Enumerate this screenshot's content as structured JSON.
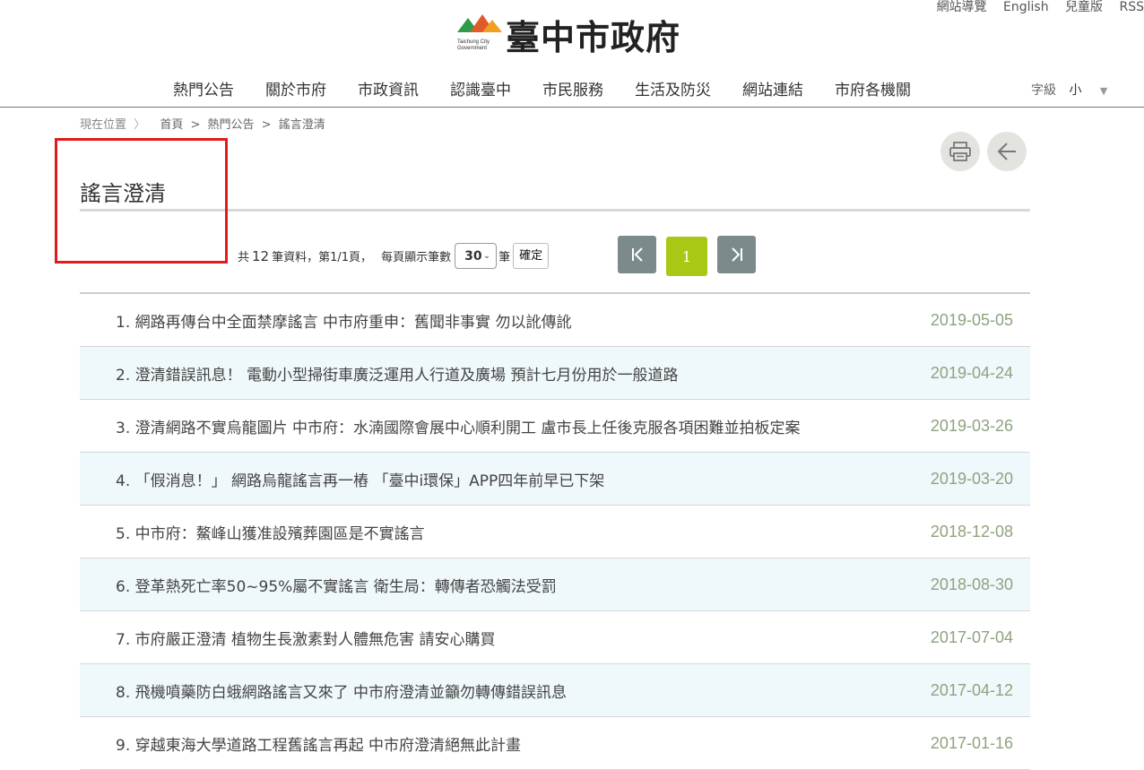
{
  "header": {
    "top_links": [
      "網站導覽",
      "English",
      "兒童版",
      "RSS"
    ],
    "logo": {
      "text": "臺中市政府",
      "caption_line1": "Taichung City",
      "caption_line2": "Government"
    },
    "nav": [
      "熱門公告",
      "關於市府",
      "市政資訊",
      "認識臺中",
      "市民服務",
      "生活及防災",
      "網站連結",
      "市府各機關"
    ],
    "font_size": {
      "label": "字級",
      "value": "小",
      "caret": "▼"
    }
  },
  "breadcrumb": {
    "current_label": "現在位置",
    "chevron": "〉",
    "items": [
      "首頁",
      "熱門公告",
      "謠言澄清"
    ],
    "separator": ">"
  },
  "page_title": "謠言澄清",
  "pager": {
    "prefix": "共",
    "total": "12",
    "records_text": "筆資料，第",
    "page_fraction": "1/1頁，",
    "per_page_label": "每頁顯示筆數",
    "per_page_value": "30",
    "per_page_unit": "筆",
    "confirm_label": "確定",
    "current_page": "1"
  },
  "list": [
    {
      "num": "1.",
      "title": "網路再傳台中全面禁摩謠言 中市府重申：舊聞非事實 勿以訛傳訛",
      "date": "2019-05-05"
    },
    {
      "num": "2.",
      "title": "澄清錯誤訊息！ 電動小型掃街車廣泛運用人行道及廣場 預計七月份用於一般道路",
      "date": "2019-04-24"
    },
    {
      "num": "3.",
      "title": "澄清網路不實烏龍圖片 中市府：水湳國際會展中心順利開工 盧市長上任後克服各項困難並拍板定案",
      "date": "2019-03-26"
    },
    {
      "num": "4.",
      "title": "「假消息！」 網路烏龍謠言再一樁 「臺中i環保」APP四年前早已下架",
      "date": "2019-03-20"
    },
    {
      "num": "5.",
      "title": "中市府：鰲峰山獲准設殯葬園區是不實謠言",
      "date": "2018-12-08"
    },
    {
      "num": "6.",
      "title": "登革熱死亡率50~95%屬不實謠言 衛生局：轉傳者恐觸法受罰",
      "date": "2018-08-30"
    },
    {
      "num": "7.",
      "title": "市府嚴正澄清 植物生長激素對人體無危害 請安心購買",
      "date": "2017-07-04"
    },
    {
      "num": "8.",
      "title": "飛機噴藥防白蛾網路謠言又來了 中市府澄清並籲勿轉傳錯誤訊息",
      "date": "2017-04-12"
    },
    {
      "num": "9.",
      "title": "穿越東海大學道路工程舊謠言再起 中市府澄清絕無此計畫",
      "date": "2017-01-16"
    }
  ],
  "colors": {
    "accent": "#a8c816",
    "pager_button": "#7d8a8c",
    "date": "#8ea37e",
    "alt_row": "#eff8fb",
    "highlight": "#e11b1b"
  }
}
